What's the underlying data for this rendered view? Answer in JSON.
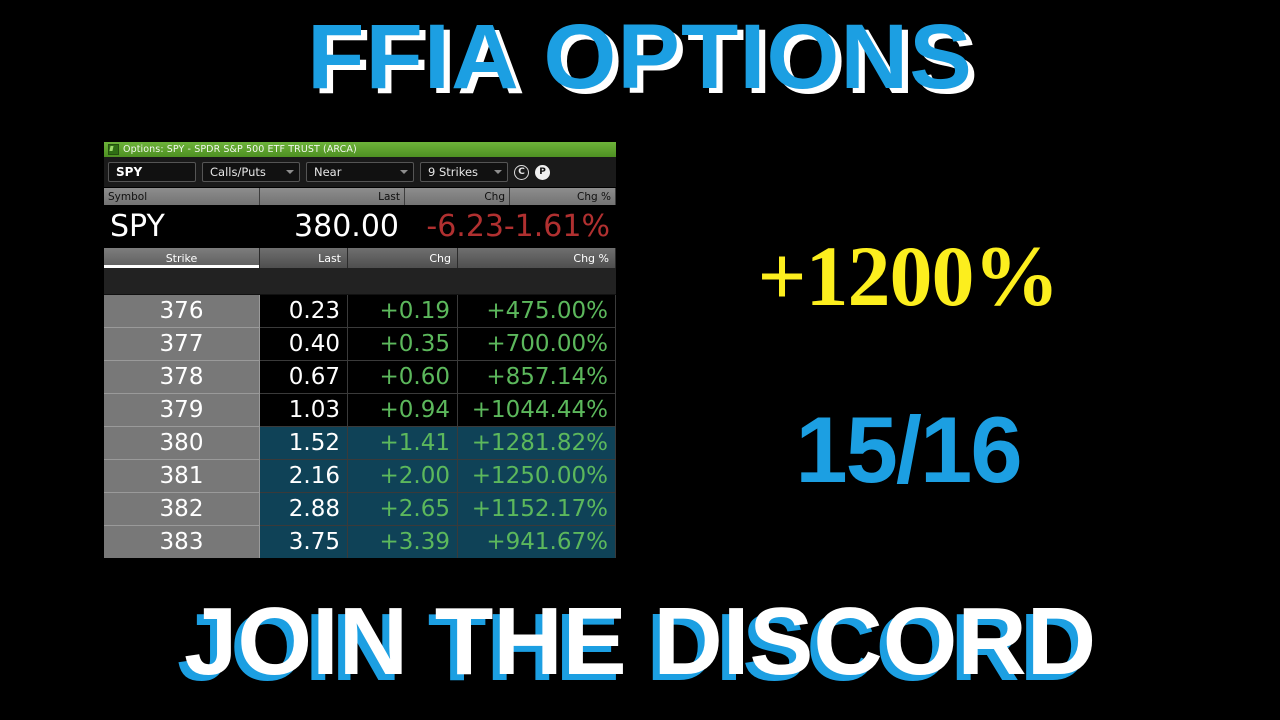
{
  "promo": {
    "headline": "FFIA OPTIONS",
    "gain_badge": "+1200%",
    "record_badge": "15/16",
    "cta": "JOIN THE DISCORD",
    "colors": {
      "accent_blue": "#1C9FE2",
      "gain_yellow": "#FCEE1E",
      "shadow_white": "#FFFFFF",
      "background": "#000000"
    }
  },
  "widget": {
    "title": "Options: SPY - SPDR S&P 500 ETF TRUST (ARCA)",
    "title_icon": "window-chart-icon",
    "toolbar": {
      "symbol_value": "SPY",
      "symbol_placeholder": "Symbol",
      "type_filter": "Calls/Puts",
      "expiry_filter": "Near",
      "strikes_filter": "9 Strikes",
      "call_button": "C",
      "put_button": "P"
    },
    "quote_header": [
      "Symbol",
      "Last",
      "Chg",
      "Chg %"
    ],
    "quote_row": {
      "symbol": "SPY",
      "last": "380.00",
      "chg": "-6.23",
      "chg_pct": "-1.61%"
    },
    "chain_header": [
      "Strike",
      "Last",
      "Chg",
      "Chg %"
    ],
    "sorted_column": "Strike",
    "chain_rows": [
      {
        "strike": "376",
        "last": "0.23",
        "chg": "+0.19",
        "chg_pct": "+475.00%",
        "highlighted": false
      },
      {
        "strike": "377",
        "last": "0.40",
        "chg": "+0.35",
        "chg_pct": "+700.00%",
        "highlighted": false
      },
      {
        "strike": "378",
        "last": "0.67",
        "chg": "+0.60",
        "chg_pct": "+857.14%",
        "highlighted": false
      },
      {
        "strike": "379",
        "last": "1.03",
        "chg": "+0.94",
        "chg_pct": "+1044.44%",
        "highlighted": false
      },
      {
        "strike": "380",
        "last": "1.52",
        "chg": "+1.41",
        "chg_pct": "+1281.82%",
        "highlighted": true
      },
      {
        "strike": "381",
        "last": "2.16",
        "chg": "+2.00",
        "chg_pct": "+1250.00%",
        "highlighted": true
      },
      {
        "strike": "382",
        "last": "2.88",
        "chg": "+2.65",
        "chg_pct": "+1152.17%",
        "highlighted": true
      },
      {
        "strike": "383",
        "last": "3.75",
        "chg": "+3.39",
        "chg_pct": "+941.67%",
        "highlighted": true
      }
    ]
  }
}
